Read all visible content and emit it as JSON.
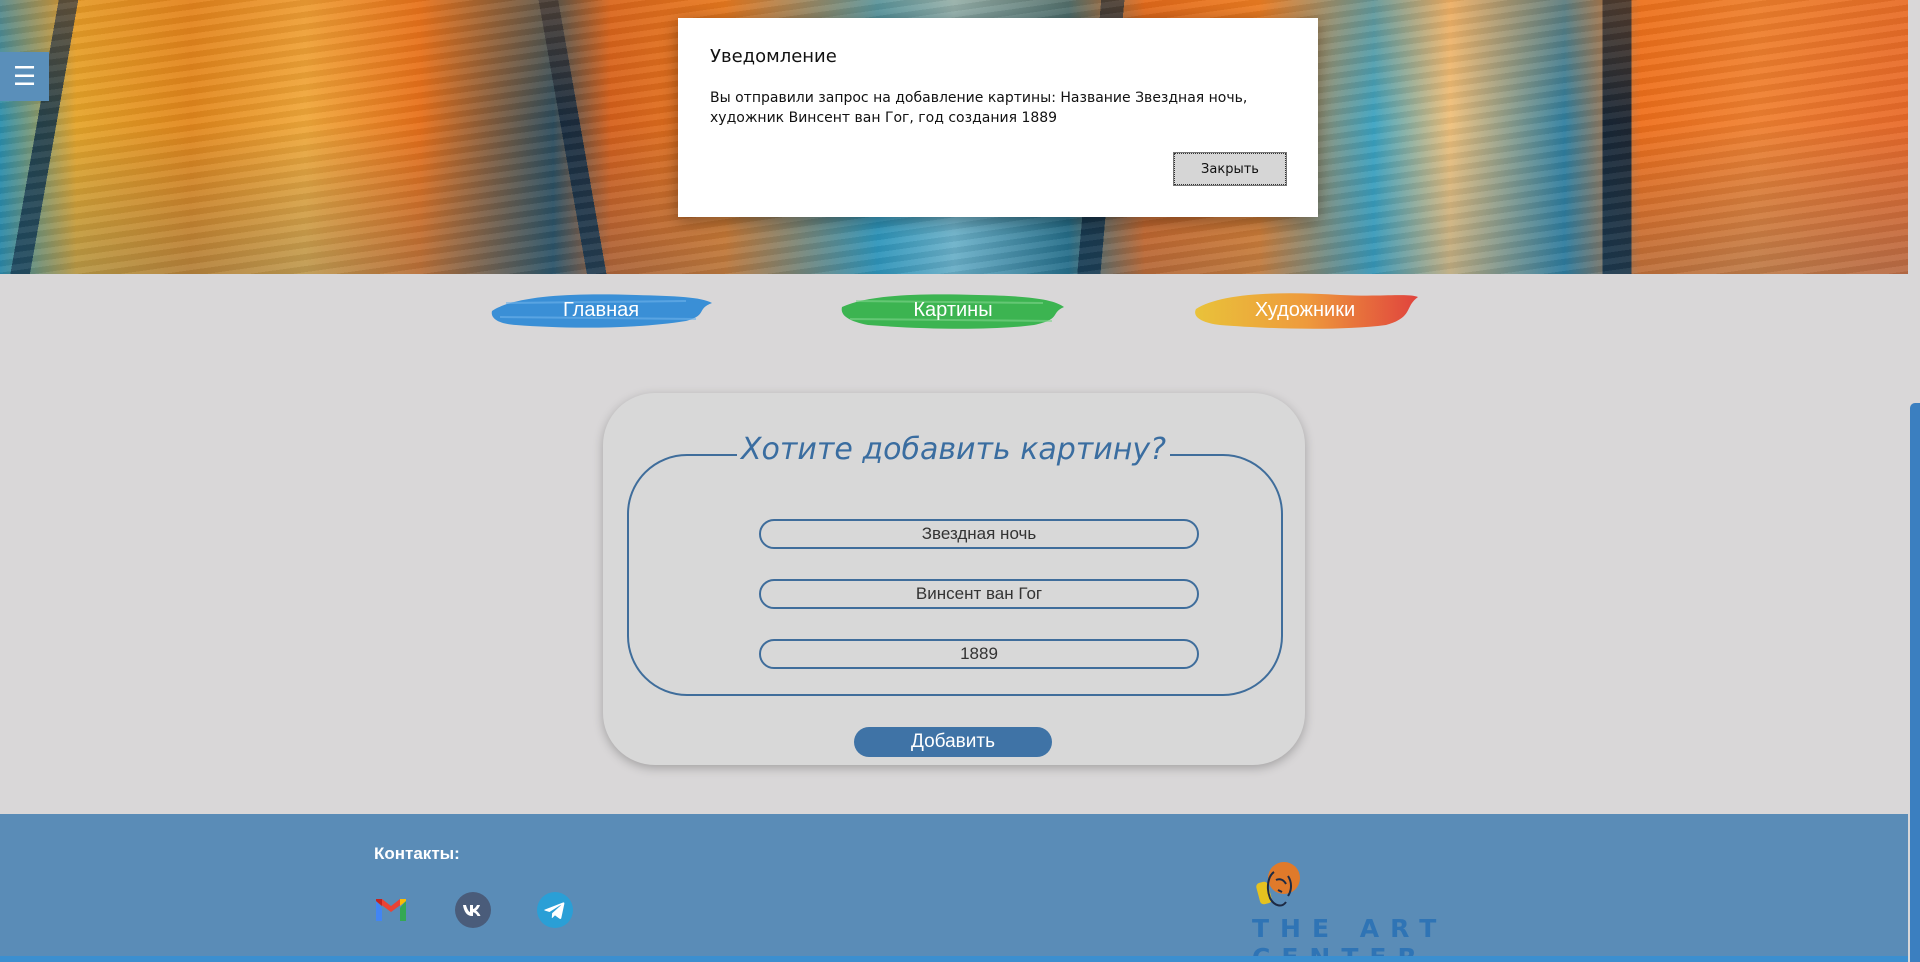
{
  "header": {
    "menu_icon": "hamburger-icon",
    "menu_glyph": "☰"
  },
  "dialog": {
    "title": "Уведомление",
    "message": "Вы отправили запрос на добавление картины: Название Звездная ночь, художник Винсент ван Гог, год создания 1889",
    "close_label": "Закрыть"
  },
  "nav": {
    "items": [
      {
        "label": "Главная",
        "color": "#3a8fd6"
      },
      {
        "label": "Картины",
        "color": "#3cb451"
      },
      {
        "label": "Художники",
        "color": "#e98b3a"
      }
    ]
  },
  "form": {
    "legend": "Хотите добавить картину?",
    "fields": [
      {
        "value": "Звездная ночь"
      },
      {
        "value": "Винсент ван Гог"
      },
      {
        "value": "1889"
      }
    ],
    "submit_label": "Добавить"
  },
  "footer": {
    "contacts_title": "Контакты:",
    "socials": [
      {
        "icon": "gmail-icon"
      },
      {
        "icon": "vk-icon"
      },
      {
        "icon": "telegram-icon"
      }
    ],
    "logo_text": "THE ART CENTER"
  },
  "colors": {
    "accent": "#3f73a6",
    "footer": "#5a8cb7",
    "page_bg": "#d9d7d8"
  }
}
